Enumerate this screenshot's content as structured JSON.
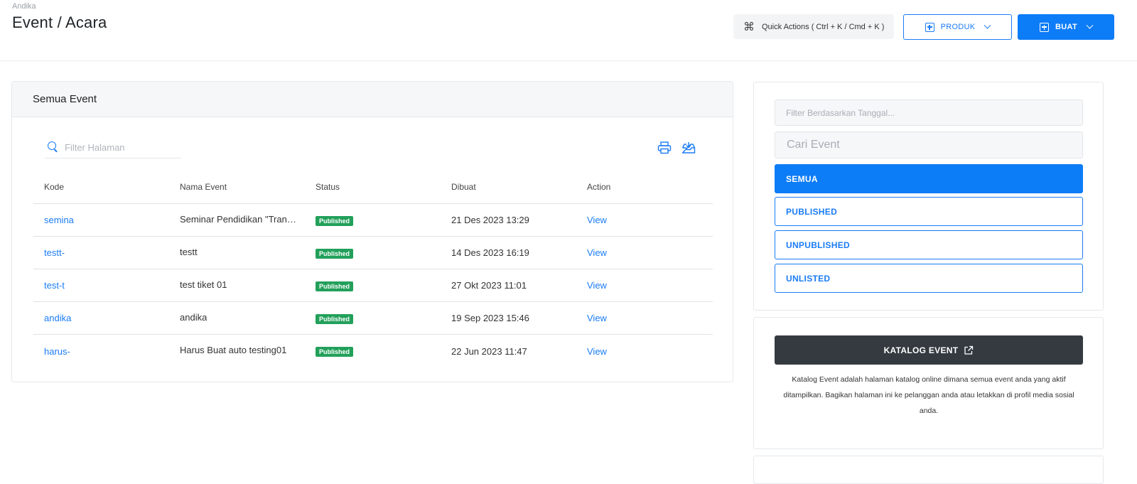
{
  "header": {
    "breadcrumb": "Andika",
    "title": "Event / Acara",
    "quick_actions": "Quick Actions ( Ctrl + K / Cmd + K )",
    "produk_label": "PRODUK",
    "buat_label": "BUAT"
  },
  "events_card": {
    "title": "Semua Event",
    "search_placeholder": "Filter Halaman",
    "columns": [
      "Kode",
      "Nama Event",
      "Status",
      "Dibuat",
      "Action"
    ],
    "rows": [
      {
        "code": "semina",
        "name": "Seminar Pendidikan \"Transformasi",
        "status": "Published",
        "created": "21 Des 2023 13:29",
        "action": "View"
      },
      {
        "code": "testt-",
        "name": "testt",
        "status": "Published",
        "created": "14 Des 2023 16:19",
        "action": "View"
      },
      {
        "code": "test-t",
        "name": "test tiket 01",
        "status": "Published",
        "created": "27 Okt 2023 11:01",
        "action": "View"
      },
      {
        "code": "andika",
        "name": "andika",
        "status": "Published",
        "created": "19 Sep 2023 15:46",
        "action": "View"
      },
      {
        "code": "harus-",
        "name": "Harus Buat auto testing01",
        "status": "Published",
        "created": "22 Jun 2023 11:47",
        "action": "View"
      }
    ]
  },
  "filter_card": {
    "date_placeholder": "Filter Berdasarkan Tanggal...",
    "search_placeholder": "Cari Event",
    "options": [
      "SEMUA",
      "PUBLISHED",
      "UNPUBLISHED",
      "UNLISTED"
    ],
    "active": "SEMUA"
  },
  "katalog_card": {
    "button_label": "KATALOG EVENT",
    "description": "Katalog Event adalah halaman katalog online dimana semua event anda yang aktif ditampilkan. Bagikan halaman ini ke pelanggan anda atau letakkan di profil media sosial anda."
  },
  "colors": {
    "primary": "#0d7cf7",
    "link": "#1a7cf5",
    "success": "#22a05a",
    "dark": "#343a40"
  }
}
